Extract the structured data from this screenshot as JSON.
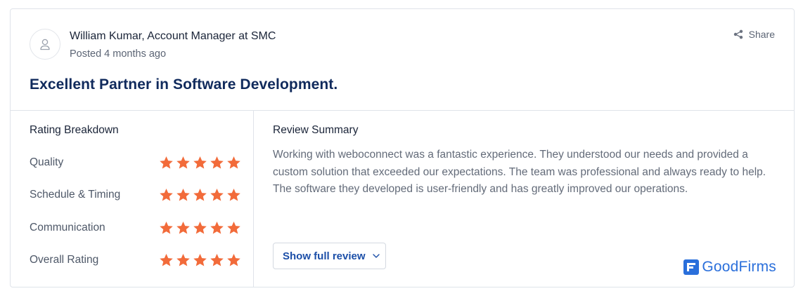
{
  "reviewer": {
    "name": "William Kumar, Account Manager at SMC",
    "posted": "Posted 4 months ago",
    "avatar_icon": "user-icon"
  },
  "share": {
    "label": "Share",
    "icon": "share-icon"
  },
  "review": {
    "title": "Excellent Partner in Software Development.",
    "summary_heading": "Review Summary",
    "summary_text": "Working with weboconnect was a fantastic experience. They understood our needs and provided a custom solution that exceeded our expectations. The team was professional and always ready to help. The software they developed is user-friendly and has greatly improved our operations.",
    "show_full_label": "Show full review"
  },
  "rating_breakdown": {
    "heading": "Rating Breakdown",
    "max_stars": 5,
    "items": [
      {
        "label": "Quality",
        "stars": 5
      },
      {
        "label": "Schedule & Timing",
        "stars": 5
      },
      {
        "label": "Communication",
        "stars": 5
      },
      {
        "label": "Overall Rating",
        "stars": 5
      }
    ]
  },
  "brand": {
    "name": "GoodFirms",
    "color": "#2a6fdb"
  },
  "colors": {
    "star": "#f26b3a",
    "link": "#1c4fa8",
    "title": "#102a5c"
  }
}
